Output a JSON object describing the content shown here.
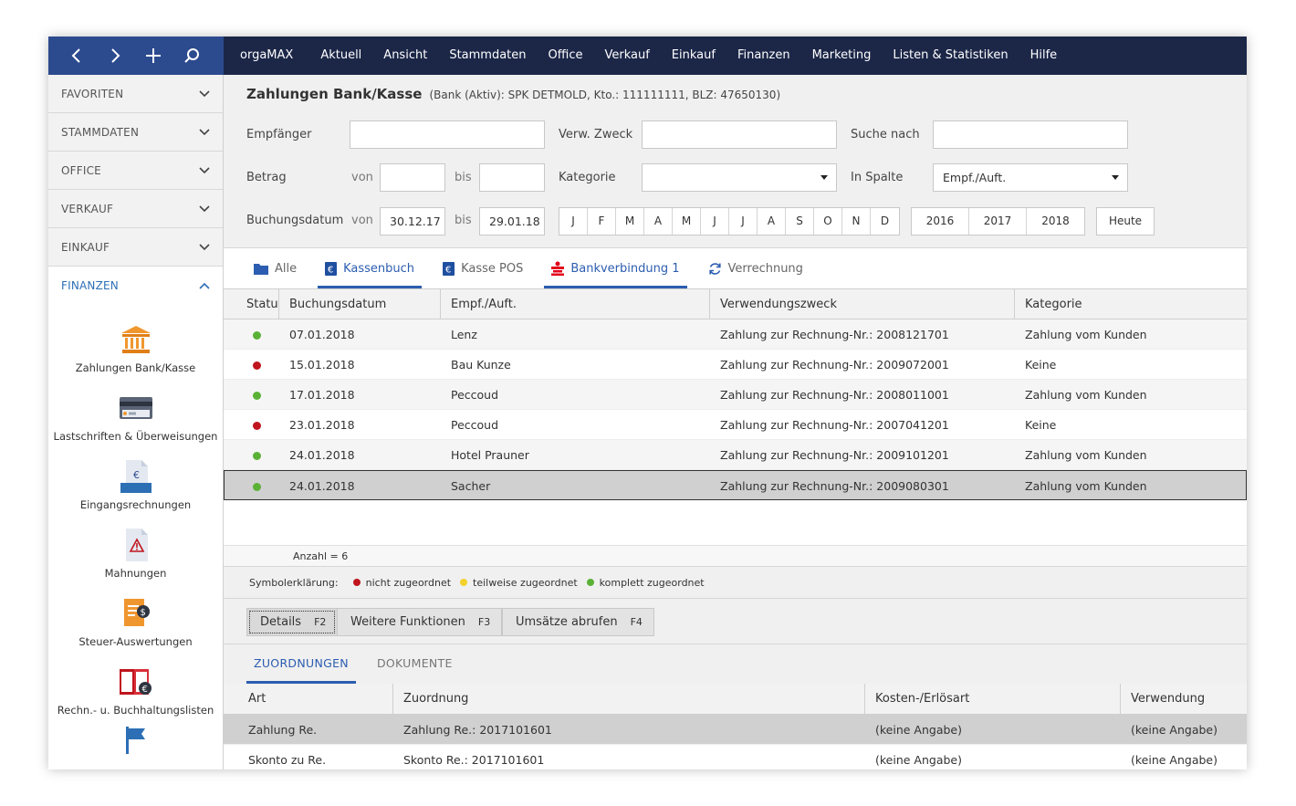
{
  "toolbar": {
    "back_icon": "chevron-left-icon",
    "forward_icon": "chevron-right-icon",
    "add_icon": "plus-icon",
    "search_icon": "search-icon"
  },
  "menu": [
    "orgaMAX",
    "Aktuell",
    "Ansicht",
    "Stammdaten",
    "Office",
    "Verkauf",
    "Einkauf",
    "Finanzen",
    "Marketing",
    "Listen & Statistiken",
    "Hilfe"
  ],
  "sidebar": {
    "sections": [
      {
        "label": "FAVORITEN"
      },
      {
        "label": "STAMMDATEN"
      },
      {
        "label": "OFFICE"
      },
      {
        "label": "VERKAUF"
      },
      {
        "label": "EINKAUF"
      },
      {
        "label": "FINANZEN"
      }
    ],
    "items": [
      {
        "label": "Zahlungen Bank/Kasse",
        "icon": "bank-icon"
      },
      {
        "label": "Lastschriften & Überweisungen",
        "icon": "card-icon"
      },
      {
        "label": "Eingangsrechnungen",
        "icon": "invoice-in-icon"
      },
      {
        "label": "Mahnungen",
        "icon": "reminder-icon"
      },
      {
        "label": "Steuer-Auswertungen",
        "icon": "tax-icon"
      },
      {
        "label": "Rechn.- u. Buchhaltungslisten",
        "icon": "ledger-icon"
      }
    ]
  },
  "header": {
    "title": "Zahlungen Bank/Kasse",
    "subtitle": "(Bank (Aktiv): SPK DETMOLD, Kto.: 111111111, BLZ: 47650130)"
  },
  "filter": {
    "empfaenger_label": "Empfänger",
    "empfaenger_value": "",
    "verwzweck_label": "Verw. Zweck",
    "verwzweck_value": "",
    "suche_label": "Suche nach",
    "suche_value": "",
    "betrag_label": "Betrag",
    "von_label": "von",
    "bis_label": "bis",
    "betrag_von": "",
    "betrag_bis": "",
    "kategorie_label": "Kategorie",
    "kategorie_value": "",
    "inspalte_label": "In Spalte",
    "inspalte_value": "Empf./Auft.",
    "buchungsdatum_label": "Buchungsdatum",
    "datum_von": "30.12.17",
    "datum_bis": "29.01.18",
    "months": [
      "J",
      "F",
      "M",
      "A",
      "M",
      "J",
      "J",
      "A",
      "S",
      "O",
      "N",
      "D"
    ],
    "years": [
      "2016",
      "2017",
      "2018"
    ],
    "today": "Heute"
  },
  "tabs": [
    {
      "label": "Alle",
      "icon": "folder-icon"
    },
    {
      "label": "Kassenbuch",
      "icon": "cashbook-icon",
      "active": true
    },
    {
      "label": "Kasse POS",
      "icon": "pos-icon"
    },
    {
      "label": "Bankverbindung 1",
      "icon": "sparkasse-icon",
      "active": true
    },
    {
      "label": "Verrechnung",
      "icon": "sync-icon"
    }
  ],
  "table": {
    "columns": [
      "Status",
      "Buchungsdatum",
      "Empf./Auft.",
      "Verwendungszweck",
      "Kategorie"
    ],
    "rows": [
      {
        "status": "green",
        "date": "07.01.2018",
        "party": "Lenz",
        "purpose": "Zahlung zur Rechnung-Nr.: 2008121701",
        "category": "Zahlung vom Kunden"
      },
      {
        "status": "red",
        "date": "15.01.2018",
        "party": "Bau Kunze",
        "purpose": "Zahlung zur Rechnung-Nr.: 2009072001",
        "category": "Keine"
      },
      {
        "status": "green",
        "date": "17.01.2018",
        "party": "Peccoud",
        "purpose": "Zahlung zur Rechnung-Nr.: 2008011001",
        "category": "Zahlung vom Kunden"
      },
      {
        "status": "red",
        "date": "23.01.2018",
        "party": "Peccoud",
        "purpose": "Zahlung zur Rechnung-Nr.: 2007041201",
        "category": "Keine"
      },
      {
        "status": "green",
        "date": "24.01.2018",
        "party": "Hotel Prauner",
        "purpose": "Zahlung zur Rechnung-Nr.: 2009101201",
        "category": "Zahlung vom Kunden"
      },
      {
        "status": "green",
        "date": "24.01.2018",
        "party": "Sacher",
        "purpose": "Zahlung zur Rechnung-Nr.: 2009080301",
        "category": "Zahlung vom Kunden",
        "selected": true
      }
    ],
    "count": "Anzahl = 6"
  },
  "legend": {
    "title": "Symbolerklärung:",
    "items": [
      {
        "label": "nicht zugeordnet",
        "color": "#c0141e"
      },
      {
        "label": "teilweise zugeordnet",
        "color": "#f2d12a"
      },
      {
        "label": "komplett zugeordnet",
        "color": "#5ab136"
      }
    ]
  },
  "actions": [
    {
      "label": "Details",
      "key": "F2"
    },
    {
      "label": "Weitere Funktionen",
      "key": "F3"
    },
    {
      "label": "Umsätze abrufen",
      "key": "F4"
    }
  ],
  "subtabs": [
    {
      "label": "ZUORDNUNGEN",
      "active": true
    },
    {
      "label": "DOKUMENTE"
    }
  ],
  "assign_table": {
    "columns": [
      "Art",
      "Zuordnung",
      "Kosten-/Erlösart",
      "Verwendung"
    ],
    "rows": [
      {
        "art": "Zahlung Re.",
        "zuordnung": "Zahlung Re.: 2017101601",
        "kosten": "(keine Angabe)",
        "verwendung": "(keine Angabe)",
        "selected": true
      },
      {
        "art": "Skonto zu Re.",
        "zuordnung": "Skonto Re.: 2017101601",
        "kosten": "(keine Angabe)",
        "verwendung": "(keine Angabe)"
      }
    ]
  },
  "colors": {
    "topbar": "#1c2748",
    "navtools": "#2c4a8e",
    "accent": "#2c5db0",
    "status_green": "#5ab136",
    "status_red": "#c0141e"
  }
}
